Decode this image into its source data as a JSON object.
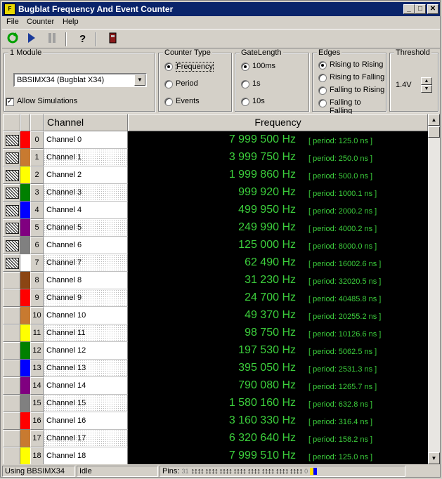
{
  "window": {
    "title": "Bugblat Frequency And Event Counter",
    "app_icon_text": "F"
  },
  "menu": [
    "File",
    "Counter",
    "Help"
  ],
  "module": {
    "label": "1 Module",
    "selected": "BBSIMX34    (Bugblat X34)",
    "allow_sim_label": "Allow Simulations",
    "allow_sim_checked": true
  },
  "counter_type": {
    "label": "Counter Type",
    "options": [
      "Frequency",
      "Period",
      "Events"
    ],
    "selected": "Frequency"
  },
  "gate_length": {
    "label": "GateLength",
    "options": [
      "100ms",
      "1s",
      "10s"
    ],
    "selected": "100ms"
  },
  "edges": {
    "label": "Edges",
    "options": [
      "Rising to Rising",
      "Rising to Falling",
      "Falling to Rising",
      "Falling to Falling"
    ],
    "selected": "Rising to Rising"
  },
  "threshold": {
    "label": "Threshold",
    "value": "1.4V"
  },
  "table": {
    "headers": {
      "channel": "Channel",
      "frequency": "Frequency"
    },
    "rows": [
      {
        "num": "0",
        "name": "Channel 0",
        "color": "#ff0000",
        "hatch": true,
        "freq": "7 999 500 Hz",
        "period": "[ period: 125.0 ns ]"
      },
      {
        "num": "1",
        "name": "Channel 1",
        "color": "#c87a30",
        "hatch": true,
        "freq": "3 999 750 Hz",
        "period": "[ period: 250.0 ns ]"
      },
      {
        "num": "2",
        "name": "Channel 2",
        "color": "#ffff00",
        "hatch": true,
        "freq": "1 999 860 Hz",
        "period": "[ period: 500.0 ns ]"
      },
      {
        "num": "3",
        "name": "Channel 3",
        "color": "#008000",
        "hatch": true,
        "freq": "999 920 Hz",
        "period": "[ period: 1000.1 ns ]"
      },
      {
        "num": "4",
        "name": "Channel 4",
        "color": "#0000ff",
        "hatch": true,
        "freq": "499 950 Hz",
        "period": "[ period: 2000.2 ns ]"
      },
      {
        "num": "5",
        "name": "Channel 5",
        "color": "#800080",
        "hatch": true,
        "freq": "249 990 Hz",
        "period": "[ period: 4000.2 ns ]"
      },
      {
        "num": "6",
        "name": "Channel 6",
        "color": "#808080",
        "hatch": true,
        "freq": "125 000 Hz",
        "period": "[ period: 8000.0 ns ]"
      },
      {
        "num": "7",
        "name": "Channel 7",
        "color": "#ffffff",
        "hatch": true,
        "freq": "62 490 Hz",
        "period": "[ period: 16002.6 ns ]"
      },
      {
        "num": "8",
        "name": "Channel 8",
        "color": "#8b4513",
        "hatch": false,
        "freq": "31 230 Hz",
        "period": "[ period: 32020.5 ns ]"
      },
      {
        "num": "9",
        "name": "Channel 9",
        "color": "#ff0000",
        "hatch": false,
        "freq": "24 700 Hz",
        "period": "[ period: 40485.8 ns ]"
      },
      {
        "num": "10",
        "name": "Channel 10",
        "color": "#c87a30",
        "hatch": false,
        "freq": "49 370 Hz",
        "period": "[ period: 20255.2 ns ]"
      },
      {
        "num": "11",
        "name": "Channel 11",
        "color": "#ffff00",
        "hatch": false,
        "freq": "98 750 Hz",
        "period": "[ period: 10126.6 ns ]"
      },
      {
        "num": "12",
        "name": "Channel 12",
        "color": "#008000",
        "hatch": false,
        "freq": "197 530 Hz",
        "period": "[ period: 5062.5 ns ]"
      },
      {
        "num": "13",
        "name": "Channel 13",
        "color": "#0000ff",
        "hatch": false,
        "freq": "395 050 Hz",
        "period": "[ period: 2531.3 ns ]"
      },
      {
        "num": "14",
        "name": "Channel 14",
        "color": "#800080",
        "hatch": false,
        "freq": "790 080 Hz",
        "period": "[ period: 1265.7 ns ]"
      },
      {
        "num": "15",
        "name": "Channel 15",
        "color": "#808080",
        "hatch": false,
        "freq": "1 580 160 Hz",
        "period": "[ period: 632.8 ns ]"
      },
      {
        "num": "16",
        "name": "Channel 16",
        "color": "#ff0000",
        "hatch": false,
        "freq": "3 160 330 Hz",
        "period": "[ period: 316.4 ns ]"
      },
      {
        "num": "17",
        "name": "Channel 17",
        "color": "#c87a30",
        "hatch": false,
        "freq": "6 320 640 Hz",
        "period": "[ period: 158.2 ns ]"
      },
      {
        "num": "18",
        "name": "Channel 18",
        "color": "#ffff00",
        "hatch": false,
        "freq": "7 999 510 Hz",
        "period": "[ period: 125.0 ns ]"
      }
    ]
  },
  "status": {
    "using": "Using BBSIMX34",
    "state": "Idle",
    "pins_label": "Pins:",
    "pins_start": "31",
    "pins_end": "0"
  },
  "colors": {
    "title_bar": "#0a246a",
    "freq_text": "#3ccf3c"
  }
}
